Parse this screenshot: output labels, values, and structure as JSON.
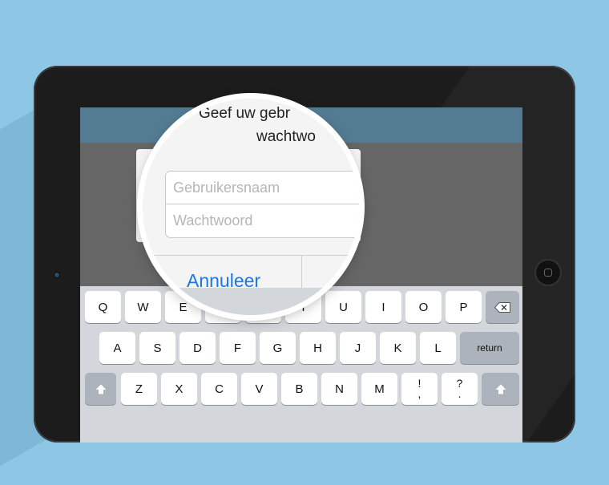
{
  "dialog": {
    "title_line1": "Geef uw gebr",
    "title_line2": "wachtwo",
    "username_placeholder": "Gebruikersnaam",
    "password_placeholder": "Wachtwoord",
    "cancel_label": "Annuleer"
  },
  "keyboard": {
    "row1": [
      "Q",
      "W",
      "E",
      "R",
      "T",
      "Y",
      "U",
      "I",
      "O",
      "P"
    ],
    "row2": [
      "A",
      "S",
      "D",
      "F",
      "G",
      "H",
      "J",
      "K",
      "L"
    ],
    "row3": [
      "Z",
      "X",
      "C",
      "V",
      "B",
      "N",
      "M"
    ],
    "return_label": "return",
    "exclam_top": "!",
    "exclam_bottom": ",",
    "question_top": "?",
    "question_bottom": ".",
    "icons": {
      "backspace": "backspace-icon",
      "shift": "shift-icon"
    }
  },
  "colors": {
    "background": "#8ec7e5",
    "nav_bar": "#537b92",
    "accent": "#1a78e8"
  }
}
